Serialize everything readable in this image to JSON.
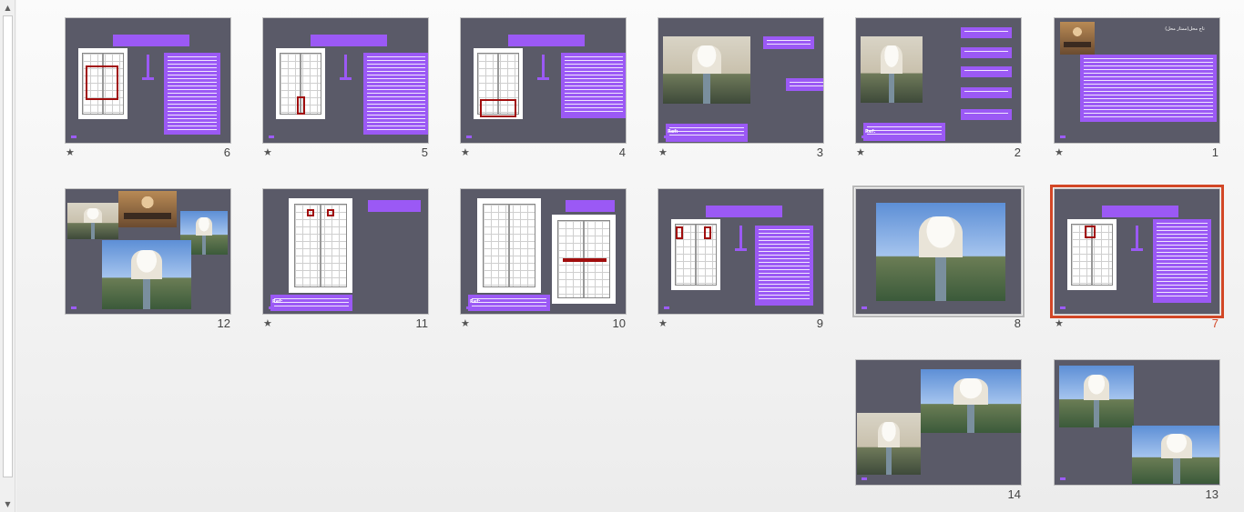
{
  "scrollbar": {
    "up_icon": "▲",
    "down_icon": "▼"
  },
  "slides": [
    {
      "number": "1",
      "title": "تاج محل(ممتاز محل)"
    },
    {
      "number": "2"
    },
    {
      "number": "3"
    },
    {
      "number": "4"
    },
    {
      "number": "5"
    },
    {
      "number": "6"
    },
    {
      "number": "7",
      "selected": true
    },
    {
      "number": "8"
    },
    {
      "number": "9"
    },
    {
      "number": "10"
    },
    {
      "number": "11"
    },
    {
      "number": "12"
    },
    {
      "number": "13"
    },
    {
      "number": "14"
    }
  ],
  "star_icon": "★",
  "ref_label": "Ref:",
  "accent_color": "#d24726",
  "placeholder_color": "#9b59f5"
}
